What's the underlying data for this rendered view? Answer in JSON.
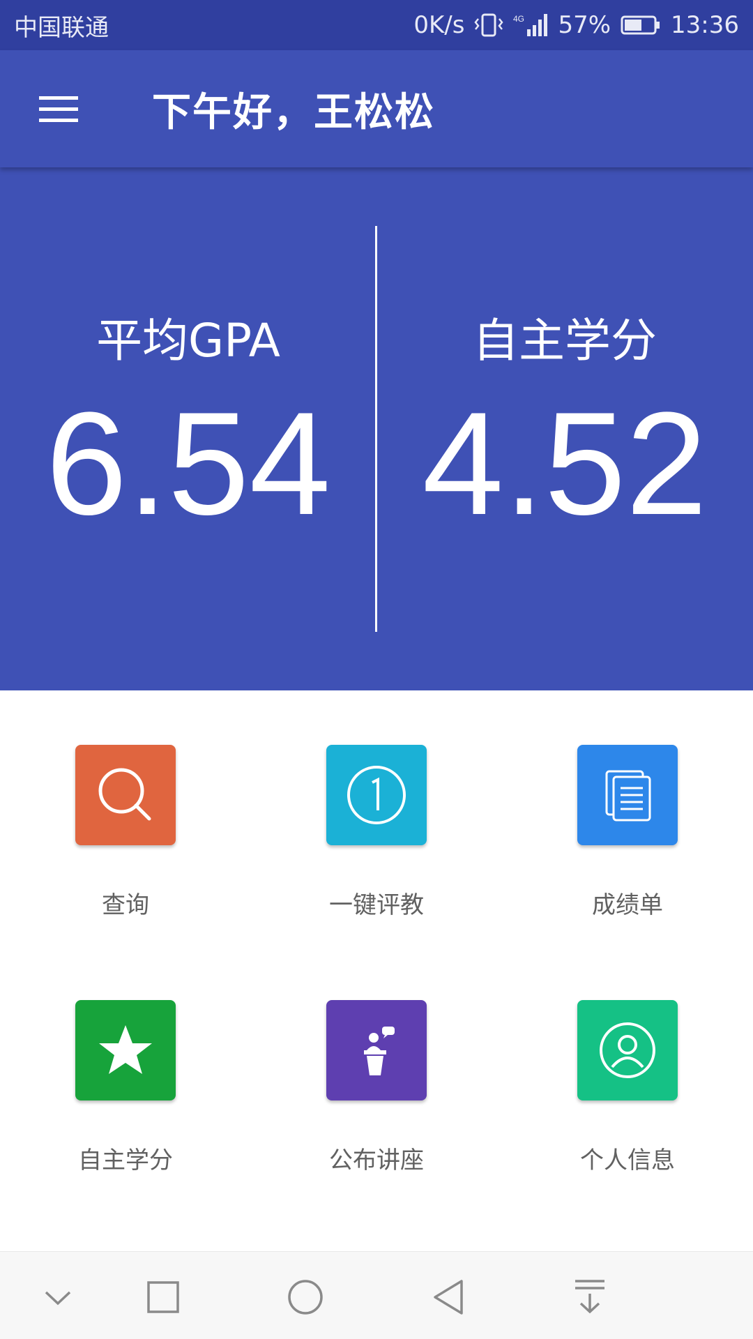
{
  "status_bar": {
    "carrier": "中国联通",
    "speed": "0K/s",
    "network": "4G",
    "battery": "57%",
    "time": "13:36"
  },
  "toolbar": {
    "title": "下午好，王松松",
    "menu_icon": "hamburger-menu-icon"
  },
  "stats": {
    "gpa": {
      "label": "平均GPA",
      "value": "6.54"
    },
    "credits": {
      "label": "自主学分",
      "value": "4.52"
    }
  },
  "menu": [
    {
      "label": "查询",
      "icon": "search-icon",
      "color": "#e0653f"
    },
    {
      "label": "一键评教",
      "icon": "number-one-icon",
      "color": "#1bb1d6"
    },
    {
      "label": "成绩单",
      "icon": "documents-icon",
      "color": "#2d87ea"
    },
    {
      "label": "自主学分",
      "icon": "star-icon",
      "color": "#17a33b"
    },
    {
      "label": "公布讲座",
      "icon": "lecture-podium-icon",
      "color": "#5e3fb0"
    },
    {
      "label": "个人信息",
      "icon": "user-profile-icon",
      "color": "#15c185"
    }
  ],
  "nav_bar": {
    "buttons": [
      "collapse-icon",
      "recent-apps-icon",
      "home-icon",
      "back-icon",
      "notification-pull-icon"
    ]
  },
  "colors": {
    "primary": "#3f51b5",
    "primary_dark": "#303f9f"
  }
}
